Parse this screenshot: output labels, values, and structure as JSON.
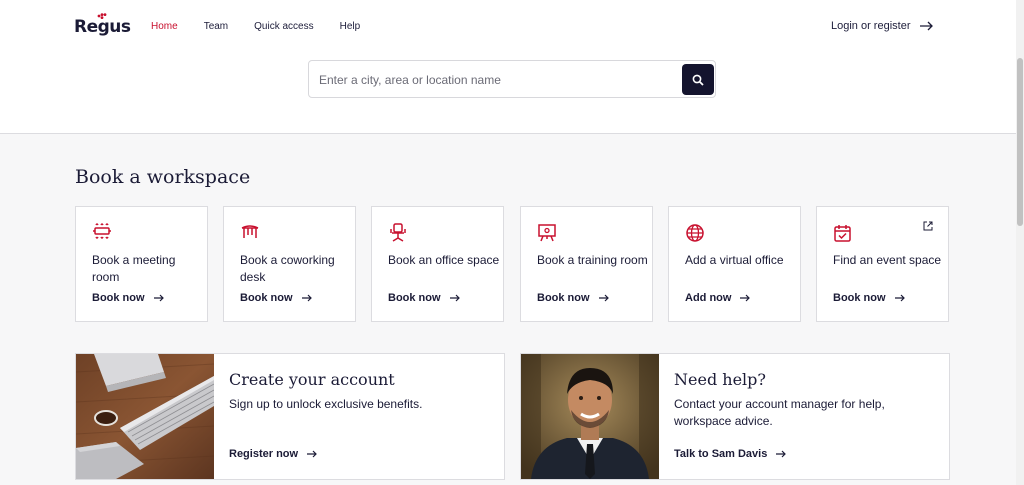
{
  "header": {
    "logo_text": "Regus",
    "nav": [
      {
        "label": "Home",
        "active": true
      },
      {
        "label": "Team",
        "active": false
      },
      {
        "label": "Quick access",
        "active": false
      },
      {
        "label": "Help",
        "active": false
      }
    ],
    "login_label": "Login or register"
  },
  "search": {
    "placeholder": "Enter a city, area or location name",
    "value": ""
  },
  "section": {
    "title": "Book a workspace"
  },
  "cards": [
    {
      "icon": "meeting-room-icon",
      "title": "Book a meeting room",
      "link": "Book now"
    },
    {
      "icon": "coworking-desk-icon",
      "title": "Book a coworking desk",
      "link": "Book now"
    },
    {
      "icon": "office-chair-icon",
      "title": "Book an office space",
      "link": "Book now"
    },
    {
      "icon": "training-room-icon",
      "title": "Book a training room",
      "link": "Book now"
    },
    {
      "icon": "globe-icon",
      "title": "Add a virtual office",
      "link": "Add now"
    },
    {
      "icon": "calendar-check-icon",
      "title": "Find an event space",
      "link": "Book now",
      "external": true
    }
  ],
  "promos": [
    {
      "image": "keyboard-desk-photo",
      "title": "Create your account",
      "text": "Sign up to unlock exclusive benefits.",
      "link": "Register now"
    },
    {
      "image": "account-manager-photo",
      "title": "Need help?",
      "text": "Contact your account manager for help, workspace advice.",
      "link": "Talk to Sam Davis"
    }
  ],
  "colors": {
    "brand_red": "#c8102e",
    "navy": "#14142e",
    "border": "#dcdce0",
    "background": "#f7f7f8"
  }
}
